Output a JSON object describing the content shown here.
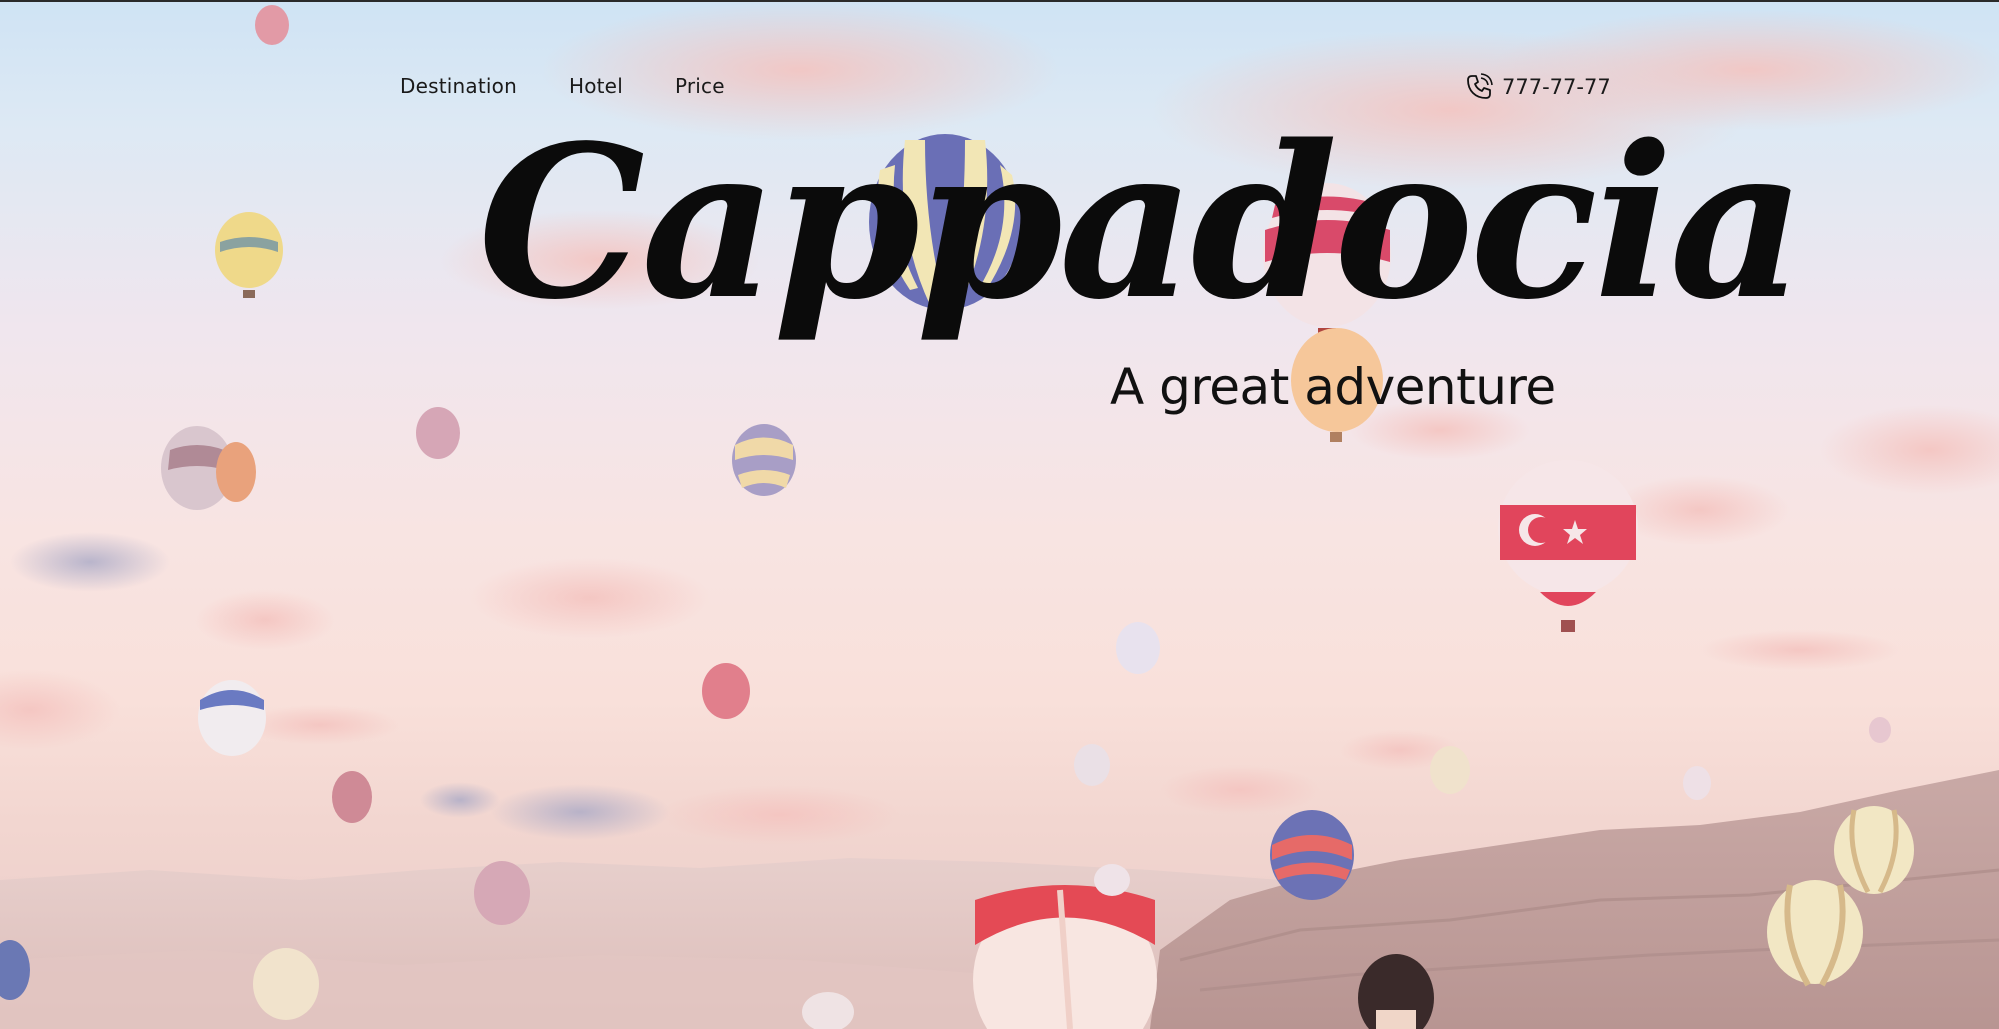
{
  "nav": {
    "items": [
      {
        "label": "Destination"
      },
      {
        "label": "Hotel"
      },
      {
        "label": "Price"
      }
    ]
  },
  "contact": {
    "icon": "phone-icon",
    "phone": "777-77-77"
  },
  "hero": {
    "title": "Cappadocia",
    "subtitle": "A great adventure",
    "background": "hot-air-balloons-over-cappadocia-photo"
  },
  "colors": {
    "text": "#111111",
    "sky_top": "#cfe3f4",
    "sky_bottom": "#f2d6d0"
  }
}
